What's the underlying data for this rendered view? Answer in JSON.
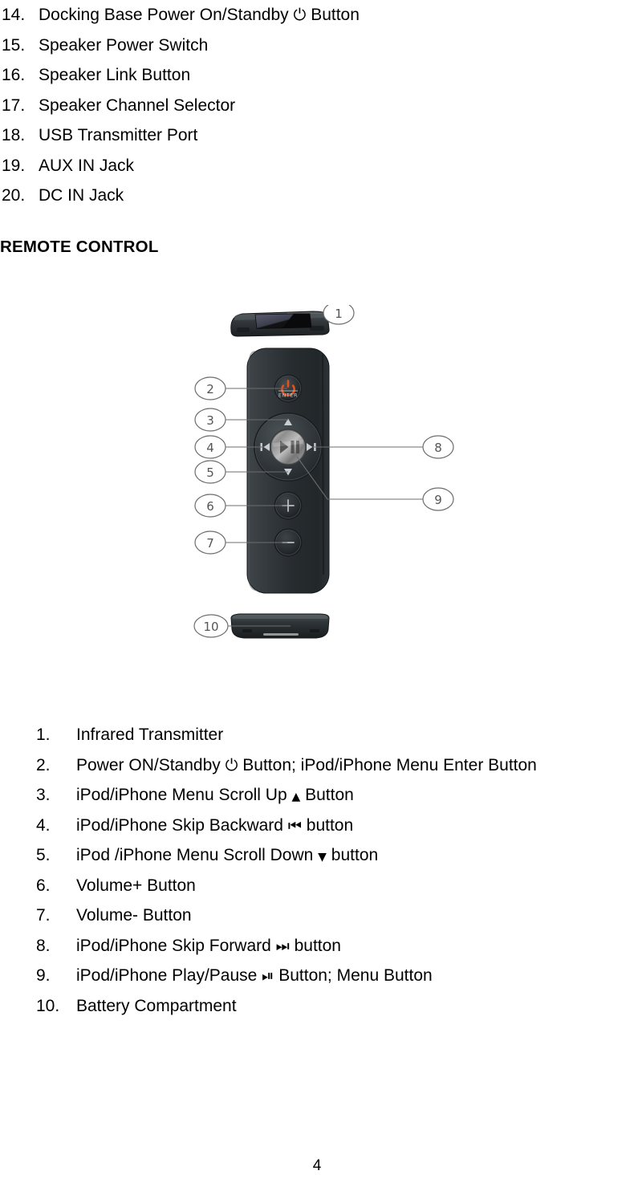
{
  "document": {
    "page_number": "4",
    "section_heading": "REMOTE CONTROL"
  },
  "top_list": {
    "items": [
      {
        "num": "14.",
        "pre": "Docking Base Power On/Standby",
        "glyph": "⏻",
        "post": "Button"
      },
      {
        "num": "15.",
        "pre": "Speaker Power Switch",
        "glyph": "",
        "post": ""
      },
      {
        "num": "16.",
        "pre": "Speaker Link Button",
        "glyph": "",
        "post": ""
      },
      {
        "num": "17.",
        "pre": "Speaker Channel Selector",
        "glyph": "",
        "post": ""
      },
      {
        "num": "18.",
        "pre": "USB Transmitter Port",
        "glyph": "",
        "post": ""
      },
      {
        "num": "19.",
        "pre": "AUX IN Jack",
        "glyph": "",
        "post": ""
      },
      {
        "num": "20.",
        "pre": "DC IN Jack",
        "glyph": "",
        "post": ""
      }
    ]
  },
  "bottom_list": {
    "items": [
      {
        "num": "1.",
        "pre": "Infrared Transmitter",
        "glyph": "",
        "post": ""
      },
      {
        "num": "2.",
        "pre": "Power ON/Standby",
        "glyph": "⏻",
        "post": "Button; iPod/iPhone Menu Enter Button"
      },
      {
        "num": "3.",
        "pre": "iPod/iPhone Menu Scroll Up",
        "glyph": "▲",
        "post": "Button"
      },
      {
        "num": "4.",
        "pre": "iPod/iPhone Skip Backward",
        "glyph": "⏮",
        "post": "button"
      },
      {
        "num": "5.",
        "pre": "iPod /iPhone Menu Scroll Down",
        "glyph": "▼",
        "post": "button"
      },
      {
        "num": "6.",
        "pre": "Volume+ Button",
        "glyph": "",
        "post": ""
      },
      {
        "num": "7.",
        "pre": "Volume- Button",
        "glyph": "",
        "post": ""
      },
      {
        "num": "8.",
        "pre": "iPod/iPhone Skip Forward",
        "glyph": "⏭",
        "post": "button"
      },
      {
        "num": "9.",
        "pre": "iPod/iPhone Play/Pause",
        "glyph": "⏯",
        "post": "Button; Menu Button"
      },
      {
        "num": "10.",
        "pre": "Battery Compartment",
        "glyph": "",
        "post": ""
      }
    ]
  },
  "figure": {
    "alt": "Exploded diagram of the remote control with numbered callouts",
    "callouts": [
      {
        "id": "1",
        "label": "1",
        "target": "infrared-transmitter"
      },
      {
        "id": "2",
        "label": "2",
        "target": "power-standby-enter-button"
      },
      {
        "id": "3",
        "label": "3",
        "target": "menu-scroll-up-button"
      },
      {
        "id": "4",
        "label": "4",
        "target": "skip-backward-button"
      },
      {
        "id": "5",
        "label": "5",
        "target": "menu-scroll-down-button"
      },
      {
        "id": "6",
        "label": "6",
        "target": "volume-up-button"
      },
      {
        "id": "7",
        "label": "7",
        "target": "volume-down-button"
      },
      {
        "id": "8",
        "label": "8",
        "target": "skip-forward-button"
      },
      {
        "id": "9",
        "label": "9",
        "target": "play-pause-menu-button"
      },
      {
        "id": "10",
        "label": "10",
        "target": "battery-compartment"
      }
    ],
    "button_labels": {
      "enter": "ENTER",
      "volume_up": "+",
      "volume_down": "−"
    },
    "colors": {
      "body_dark": "#2b3033",
      "body_light": "#3d4347",
      "body_edge": "#1d2123",
      "power_icon": "#e2521d",
      "callout_stroke": "#6d6d6d",
      "center_button": "#9a9a9a"
    }
  }
}
